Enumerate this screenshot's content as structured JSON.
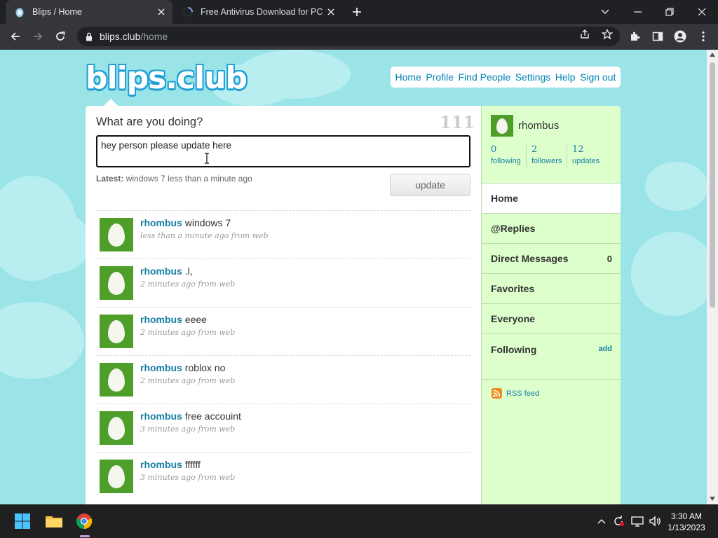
{
  "browser": {
    "tabs": [
      {
        "title": "Blips / Home",
        "active": true
      },
      {
        "title": "Free Antivirus Download for PC |",
        "active": false
      }
    ],
    "url_host": "blips.club",
    "url_path": "/home"
  },
  "site": {
    "logo_text": "blips.club",
    "nav": [
      "Home",
      "Profile",
      "Find People",
      "Settings",
      "Help",
      "Sign out"
    ]
  },
  "compose": {
    "prompt": "What are you doing?",
    "char_count": "111",
    "status_text": "hey person please update here",
    "latest_label": "Latest:",
    "latest_text": "windows 7 less than a minute ago",
    "update_label": "update"
  },
  "timeline": [
    {
      "user": "rhombus",
      "text": "windows 7",
      "meta": "less than a minute ago from web"
    },
    {
      "user": "rhombus",
      "text": ".l,",
      "meta": "2 minutes ago from web"
    },
    {
      "user": "rhombus",
      "text": "eeee",
      "meta": "2 minutes ago from web"
    },
    {
      "user": "rhombus",
      "text": "roblox no",
      "meta": "2 minutes ago from web"
    },
    {
      "user": "rhombus",
      "text": "free accouint",
      "meta": "3 minutes ago from web"
    },
    {
      "user": "rhombus",
      "text": "ffffff",
      "meta": "3 minutes ago from web"
    }
  ],
  "sidebar": {
    "username": "rhombus",
    "stats": [
      {
        "num": "0",
        "label": "following"
      },
      {
        "num": "2",
        "label": "followers"
      },
      {
        "num": "12",
        "label": "updates"
      }
    ],
    "menu": [
      {
        "label": "Home",
        "count": ""
      },
      {
        "label": "@Replies",
        "count": ""
      },
      {
        "label": "Direct Messages",
        "count": "0"
      },
      {
        "label": "Favorites",
        "count": ""
      },
      {
        "label": "Everyone",
        "count": ""
      },
      {
        "label": "Following",
        "count": ""
      }
    ],
    "following_add": "add",
    "rss_label": "RSS feed"
  },
  "taskbar": {
    "time": "3:30 AM",
    "date": "1/13/2023"
  },
  "colors": {
    "page_bg": "#9ae4e8",
    "link": "#0084b4",
    "avatar_green": "#4e9e2a",
    "sidebar_bg": "#ddffcc"
  }
}
